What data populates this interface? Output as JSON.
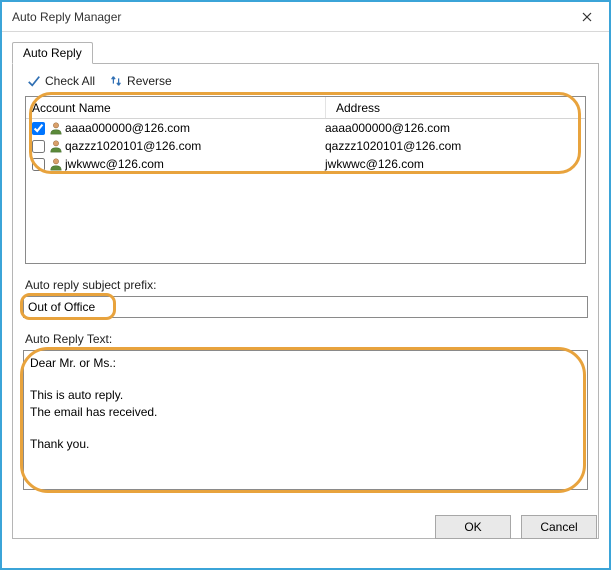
{
  "window": {
    "title": "Auto Reply Manager"
  },
  "tabs": {
    "auto_reply": "Auto Reply"
  },
  "toolbar": {
    "check_all": "Check All",
    "reverse": "Reverse"
  },
  "list": {
    "header_account": "Account Name",
    "header_address": "Address",
    "rows": [
      {
        "checked": true,
        "account": "aaaa000000@126.com",
        "address": "aaaa000000@126.com"
      },
      {
        "checked": false,
        "account": "qazzz1020101@126.com",
        "address": "qazzz1020101@126.com"
      },
      {
        "checked": false,
        "account": "jwkwwc@126.com",
        "address": "jwkwwc@126.com"
      }
    ]
  },
  "subject": {
    "label": "Auto reply subject prefix:",
    "value": "Out of Office"
  },
  "body": {
    "label": "Auto Reply Text:",
    "value": "Dear Mr. or Ms.:\n\nThis is auto reply.\nThe email has received.\n\nThank you.\n"
  },
  "buttons": {
    "ok": "OK",
    "cancel": "Cancel"
  }
}
